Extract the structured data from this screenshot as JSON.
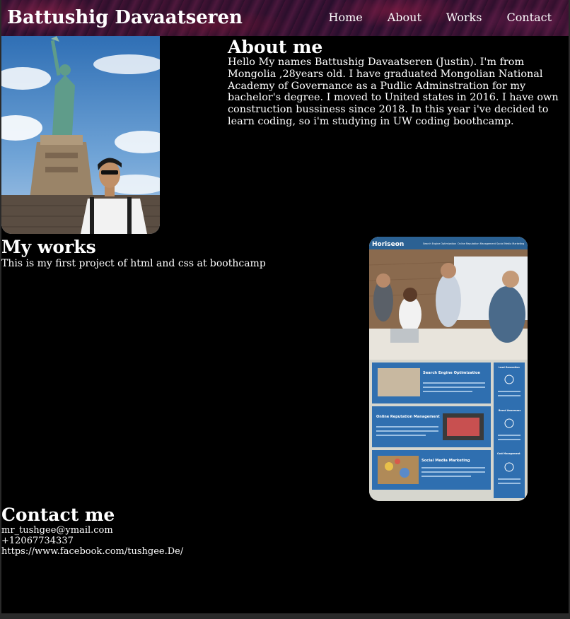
{
  "header": {
    "brand": "Battushig Davaatseren",
    "nav": [
      "Home",
      "About",
      "Works",
      "Contact"
    ]
  },
  "about": {
    "title": "About me",
    "text": "Hello My names Battushig Davaatseren (Justin). I'm from Mongolia ,28years old. I have graduated Mongolian National Academy of Governance as a Pudlic Adminstration for my bachelor's degree. I moved to United states in 2016. I have own construction bussiness since 2018. In this year i've decided to learn coding, so i'm studying in UW coding boothcamp."
  },
  "works": {
    "title": "My works",
    "text": "This is my first project of html and css at boothcamp",
    "project": {
      "logo": "Horiseon",
      "nav": [
        "Search Engine Optimization",
        "Online Reputation Management",
        "Social Media Marketing"
      ],
      "cards": [
        "Search Engine Optimization",
        "Online Reputation Management",
        "Social Media Marketing"
      ],
      "benefits": [
        "Lead Generation",
        "Brand Awareness",
        "Cost Management"
      ]
    }
  },
  "contact": {
    "title": "Contact me",
    "email": "mr_tushgee@ymail.com",
    "phone": "+12067734337",
    "facebook": "https://www.facebook.com/tushgee.De/"
  },
  "colors": {
    "background": "#000000",
    "text": "#ffffff",
    "header_tint": "#3a1230",
    "project_blue": "#2f6fb0"
  }
}
